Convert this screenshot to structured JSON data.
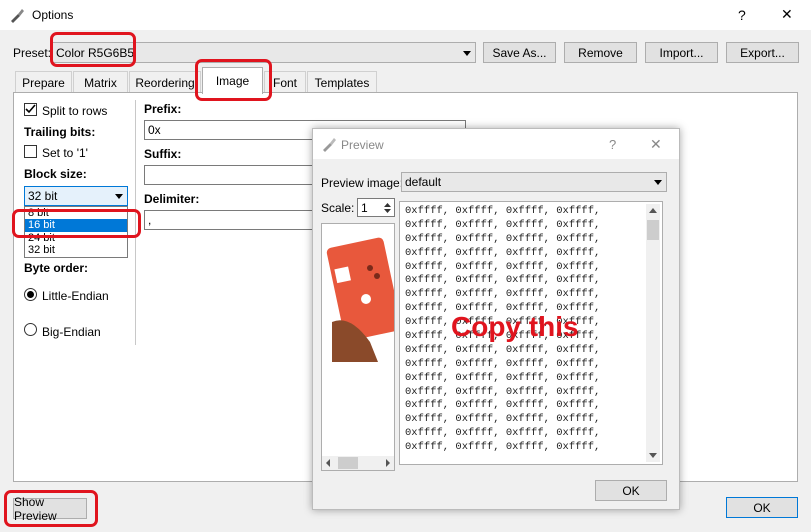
{
  "window": {
    "title": "Options",
    "help": "?",
    "close": "✕"
  },
  "preset": {
    "label": "Preset:",
    "value": "Color R5G6B5",
    "buttons": [
      "Save As...",
      "Remove",
      "Import...",
      "Export..."
    ]
  },
  "tabs": [
    "Prepare",
    "Matrix",
    "Reordering",
    "Image",
    "Font",
    "Templates"
  ],
  "active_tab": "Image",
  "left": {
    "split_to_rows": "Split to rows",
    "trailing_bits": "Trailing bits:",
    "set_to_1": "Set to '1'",
    "block_size": "Block size:",
    "block_size_value": "32 bit",
    "block_options": [
      "8 bit",
      "16 bit",
      "24 bit",
      "32 bit"
    ],
    "byte_order": "Byte order:",
    "little_endian": "Little-Endian",
    "big_endian": "Big-Endian"
  },
  "fields": {
    "prefix_label": "Prefix:",
    "prefix_value": "0x",
    "suffix_label": "Suffix:",
    "suffix_value": "",
    "delimiter_label": "Delimiter:",
    "delimiter_value": ","
  },
  "preview": {
    "title": "Preview",
    "help": "?",
    "close": "✕",
    "image_label": "Preview image:",
    "image_value": "default",
    "scale_label": "Scale:",
    "scale_value": "1",
    "ok": "OK",
    "overlay_text": "Copy this",
    "hex_line": "0xffff, 0xffff, 0xffff, 0xffff,"
  },
  "bottom": {
    "show_preview": "Show Preview",
    "ok": "OK"
  },
  "colors": {
    "annotation_red": "#e0141e",
    "selection_blue": "#0078d7",
    "photo_orange": "#e8583c"
  }
}
